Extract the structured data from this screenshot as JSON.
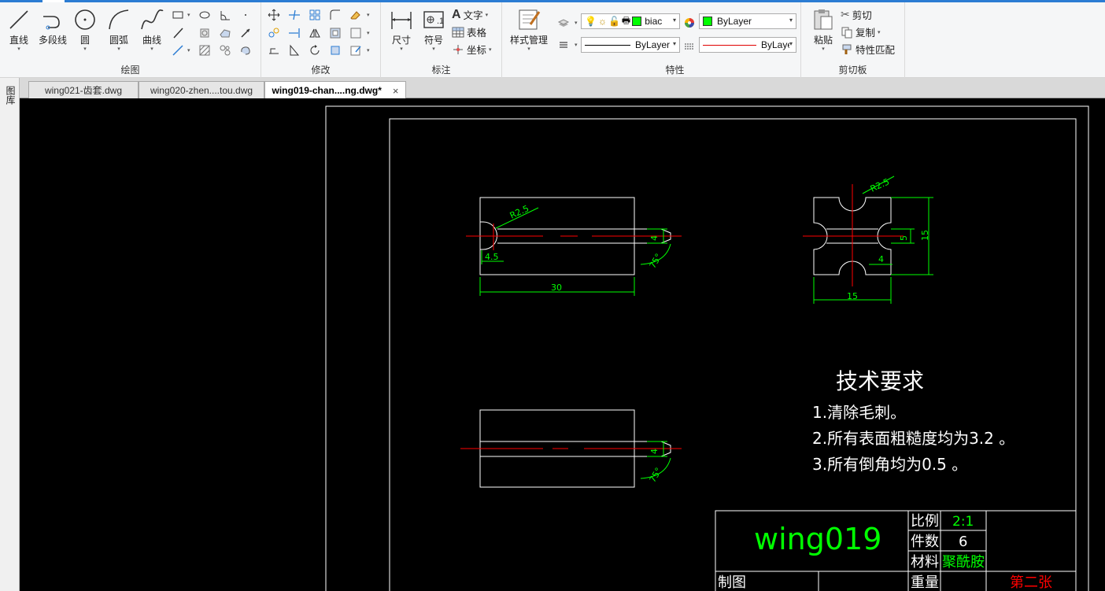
{
  "ribbon": {
    "draw": {
      "label": "绘图",
      "line": "直线",
      "polyline": "多段线",
      "circle": "圆",
      "arc": "圆弧",
      "curve": "曲线"
    },
    "modify": {
      "label": "修改"
    },
    "annotate": {
      "label": "标注",
      "dimension": "尺寸",
      "symbol": "符号",
      "text": "文字",
      "table": "表格",
      "coordinate": "坐标"
    },
    "style": {
      "label": "样式管理"
    },
    "properties": {
      "label": "特性",
      "layer_value": "biac",
      "color_value": "ByLayer",
      "linetype_value": "ByLayer",
      "lineweight_value": "ByLayer",
      "layer_color": "#00ff00"
    },
    "clipboard": {
      "label": "剪切板",
      "paste": "粘贴",
      "cut": "剪切",
      "copy": "复制",
      "match": "特性匹配"
    }
  },
  "tabs": [
    {
      "title": "wing021-齿套.dwg",
      "active": false
    },
    {
      "title": "wing020-zhen....tou.dwg",
      "active": false
    },
    {
      "title": "wing019-chan....ng.dwg*",
      "active": true
    }
  ],
  "tab_close": "×",
  "side_panel": {
    "label": "图库"
  },
  "drawing": {
    "colors": {
      "outline": "#ffffff",
      "dimension": "#00ff00",
      "center": "#ff0000",
      "title_text": "#00ff00",
      "sheet_text": "#ff0000"
    },
    "front_view_dims": {
      "radius": "R2.5",
      "depth": "4.5",
      "length": "30",
      "width": "4",
      "angle": "75°"
    },
    "side_view_dims": {
      "radius": "R2.5",
      "height": "15",
      "slot": "5",
      "depth": "4",
      "width": "15"
    },
    "bottom_view_dims": {
      "width": "4",
      "angle": "75°"
    },
    "tech_requirements": {
      "title": "技术要求",
      "items": [
        "1.清除毛刺。",
        "2.所有表面粗糙度均为3.2 。",
        "3.所有倒角均为0.5 。"
      ]
    },
    "title_block": {
      "part_name": "wing019",
      "scale_label": "比例",
      "scale_value": "2:1",
      "count_label": "件数",
      "count_value": "6",
      "material_label": "材料",
      "material_value": "聚酰胺",
      "drawn_label": "制图",
      "weight_label": "重量",
      "sheet": "第二张"
    }
  }
}
